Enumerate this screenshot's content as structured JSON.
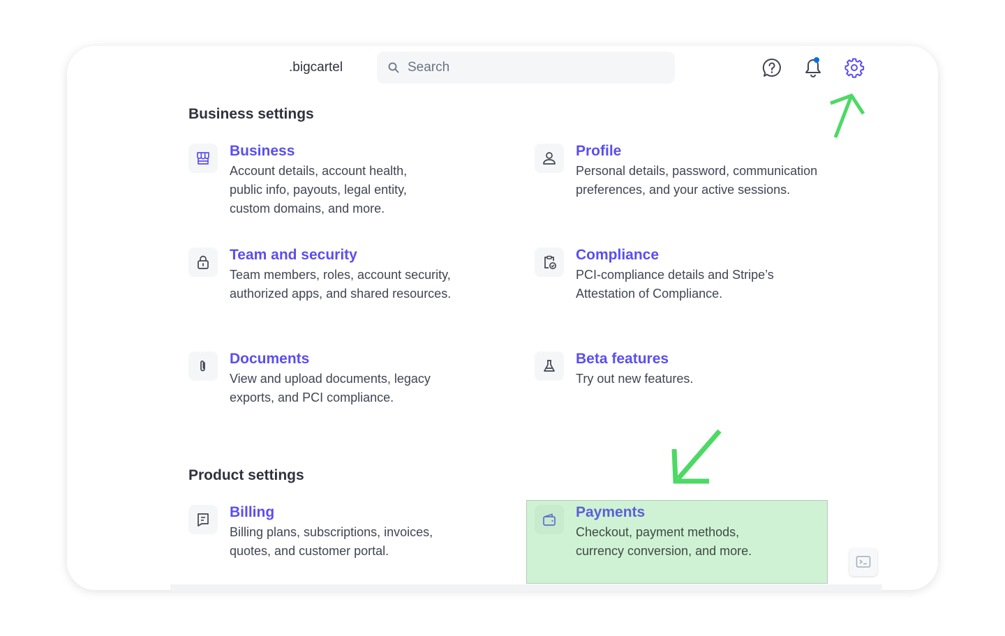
{
  "header": {
    "logo": ".bigcartel",
    "search_placeholder": "Search",
    "icons": [
      "help-icon",
      "bell-icon",
      "gear-icon"
    ],
    "notification_dot_color": "#0570de",
    "active_icon_color": "#5b4ef0"
  },
  "business_settings": {
    "title": "Business settings",
    "items": [
      {
        "title": "Business",
        "description": "Account details, account health, public info, payouts, legal entity, custom domains, and more.",
        "icon": "storefront-icon"
      },
      {
        "title": "Profile",
        "description": "Personal details, password, communication preferences, and your active sessions.",
        "icon": "person-icon"
      },
      {
        "title": "Team and security",
        "description": "Team members, roles, account security, authorized apps, and shared resources.",
        "icon": "lock-icon"
      },
      {
        "title": "Compliance",
        "description": "PCI-compliance details and Stripe’s Attestation of Compliance.",
        "icon": "clipboard-check-icon"
      },
      {
        "title": "Documents",
        "description": "View and upload documents, legacy exports, and PCI compliance.",
        "icon": "paperclip-icon"
      },
      {
        "title": "Beta features",
        "description": "Try out new features.",
        "icon": "flask-icon"
      }
    ]
  },
  "product_settings": {
    "title": "Product settings",
    "items": [
      {
        "title": "Billing",
        "description": "Billing plans, subscriptions, invoices, quotes, and customer portal.",
        "icon": "receipt-icon"
      },
      {
        "title": "Payments",
        "description": "Checkout, payment methods, currency conversion, and more.",
        "icon": "wallet-icon",
        "highlighted": true
      }
    ]
  },
  "colors": {
    "link": "#5b4ef0",
    "annotation_arrow": "#4cd964",
    "highlight": "#cdf1d3"
  }
}
